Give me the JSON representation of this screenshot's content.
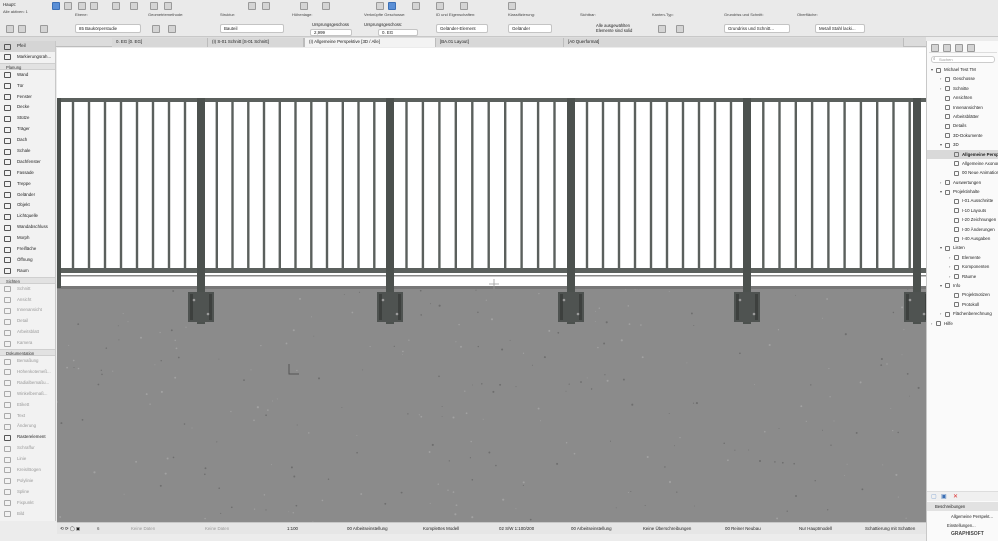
{
  "infobox": {
    "title": "Haupt:",
    "selected": "Alle aktiven: 1",
    "groups": {
      "ebene": {
        "label": "Ebene:",
        "value": "85 Baukörperstudie"
      },
      "geometry": {
        "label": "Geometriemethode:"
      },
      "struktur": {
        "label": "Struktur:",
        "value": "Bauteil"
      },
      "hoehenlage": {
        "label": "Höhenlage:",
        "origin_label": "Ursprungsgeschoss",
        "value": "2,999"
      },
      "geschosse": {
        "label": "Verknüpfte Geschosse:",
        "origin_label": "Ursprungsgeschoss:",
        "value": "0. EG"
      },
      "id": {
        "label": "ID und Eigenschaften:",
        "value": "Geländer-Element"
      },
      "klassifizierung": {
        "label": "Klassifizierung:",
        "value": "Geländer"
      },
      "sichtbar": {
        "label": "Sichtbar:",
        "value": "Alle ausgewählten Elemente sind solid"
      },
      "kanten": {
        "label": "Kanten-Typ:"
      },
      "grundriss": {
        "label": "Grundriss und Schnitt:",
        "value": "Grundriss und Schnitt..."
      },
      "oberflaeche": {
        "label": "Oberfläche:",
        "value": "Metall Stahl lacki..."
      }
    }
  },
  "tabs": [
    {
      "label": "0. EG [0. EG]"
    },
    {
      "label": "(I) S-01 Schnitt [S-01 Schnitt]"
    },
    {
      "label": "(I) Allgemeine Perspektive [3D / Alle]"
    },
    {
      "label": "[BA.01 Layout]"
    },
    {
      "label": "[A0 Querformat]"
    }
  ],
  "toolbox": {
    "sections": [
      {
        "title": "",
        "tools": [
          {
            "label": "Pfeil",
            "dim": false,
            "sel": true
          },
          {
            "label": "Markierungsrah...",
            "dim": false
          }
        ]
      },
      {
        "title": "Planung",
        "tools": [
          {
            "label": "Wand"
          },
          {
            "label": "Tür"
          },
          {
            "label": "Fenster"
          },
          {
            "label": "Decke"
          },
          {
            "label": "Stütze"
          },
          {
            "label": "Träger"
          },
          {
            "label": "Dach"
          },
          {
            "label": "Schale"
          },
          {
            "label": "Dachfenster"
          },
          {
            "label": "Fassade"
          },
          {
            "label": "Treppe"
          },
          {
            "label": "Geländer"
          },
          {
            "label": "Objekt"
          },
          {
            "label": "Lichtquelle"
          },
          {
            "label": "Wandabschluss"
          },
          {
            "label": "Morph"
          },
          {
            "label": "Freifläche"
          },
          {
            "label": "Öffnung"
          },
          {
            "label": "Raum"
          }
        ]
      },
      {
        "title": "Sichten",
        "tools": [
          {
            "label": "Schnitt",
            "dim": true
          },
          {
            "label": "Ansicht",
            "dim": true
          },
          {
            "label": "Innenansicht",
            "dim": true
          },
          {
            "label": "Detail",
            "dim": true
          },
          {
            "label": "Arbeitsblatt",
            "dim": true
          },
          {
            "label": "Kamera",
            "dim": true
          }
        ]
      },
      {
        "title": "Dokumentation",
        "tools": [
          {
            "label": "Bemaßung",
            "dim": true
          },
          {
            "label": "Höhenkotemeß...",
            "dim": true
          },
          {
            "label": "Radialbemaßu...",
            "dim": true
          },
          {
            "label": "Winkelbemaß...",
            "dim": true
          },
          {
            "label": "Etikett",
            "dim": true
          },
          {
            "label": "Text",
            "dim": true
          },
          {
            "label": "Änderung",
            "dim": true
          },
          {
            "label": "Rasterelement"
          },
          {
            "label": "Schraffur",
            "dim": true
          },
          {
            "label": "Linie",
            "dim": true
          },
          {
            "label": "Kreis/Bogen",
            "dim": true
          },
          {
            "label": "Polylinie",
            "dim": true
          },
          {
            "label": "Spline",
            "dim": true
          },
          {
            "label": "Fixpunkt",
            "dim": true
          },
          {
            "label": "Bild",
            "dim": true
          },
          {
            "label": "Zeichnung",
            "dim": true
          }
        ]
      }
    ]
  },
  "navigator": {
    "search_placeholder": "Suchen",
    "items": [
      {
        "label": "Michael Test TM",
        "level": 0,
        "arrow": "▾"
      },
      {
        "label": "Geschosse",
        "level": 1,
        "arrow": "›"
      },
      {
        "label": "Schnitte",
        "level": 1,
        "arrow": "›"
      },
      {
        "label": "Ansichten",
        "level": 1,
        "arrow": ""
      },
      {
        "label": "Innenansichten",
        "level": 1,
        "arrow": ""
      },
      {
        "label": "Arbeitsblätter",
        "level": 1,
        "arrow": ""
      },
      {
        "label": "Details",
        "level": 1,
        "arrow": ""
      },
      {
        "label": "3D-Dokumente",
        "level": 1,
        "arrow": ""
      },
      {
        "label": "3D",
        "level": 1,
        "arrow": "▾"
      },
      {
        "label": "Allgemeine Perspektive",
        "level": 2,
        "arrow": "",
        "sel": true
      },
      {
        "label": "Allgemeine Axonometrie",
        "level": 2,
        "arrow": ""
      },
      {
        "label": "00 Neue Animationen",
        "level": 2,
        "arrow": ""
      },
      {
        "label": "Auswertungen",
        "level": 1,
        "arrow": "›"
      },
      {
        "label": "Projektinhalte",
        "level": 1,
        "arrow": "▾"
      },
      {
        "label": "I-01 Ausschnitte",
        "level": 2,
        "arrow": ""
      },
      {
        "label": "I-10 Layouts",
        "level": 2,
        "arrow": ""
      },
      {
        "label": "I-20 Zeichnungen",
        "level": 2,
        "arrow": ""
      },
      {
        "label": "I-30 Änderungen",
        "level": 2,
        "arrow": ""
      },
      {
        "label": "I-40 Ausgaben",
        "level": 2,
        "arrow": ""
      },
      {
        "label": "Listen",
        "level": 1,
        "arrow": "▾"
      },
      {
        "label": "Elemente",
        "level": 2,
        "arrow": "›"
      },
      {
        "label": "Komponenten",
        "level": 2,
        "arrow": "›"
      },
      {
        "label": "Räume",
        "level": 2,
        "arrow": "›"
      },
      {
        "label": "Info",
        "level": 1,
        "arrow": "▾"
      },
      {
        "label": "Projektnotizen",
        "level": 2,
        "arrow": ""
      },
      {
        "label": "Protokoll",
        "level": 2,
        "arrow": ""
      },
      {
        "label": "Flächenberechnung",
        "level": 1,
        "arrow": "›"
      },
      {
        "label": "Hilfe",
        "level": 0,
        "arrow": "›"
      }
    ],
    "descriptions_title": "Beschreibungen",
    "current_view": "Allgemeine Perspekt...",
    "settings_button": "Einstellungen...",
    "brand": "GRAPHISOFT"
  },
  "statusbar": {
    "undo_a": "Keine Daten",
    "undo_b": "Keine Daten",
    "scale": "1:100",
    "layer_combo": "00 Arbeitseinstellung",
    "model_view": "Komplettes Modell",
    "pen_set": "02 S/W 1:100/200",
    "layer_combo2": "00 Arbeitseinstellung",
    "overrides": "Keine Überschreibungen",
    "renovation": "00 Reiner Neubau",
    "model_filter": "Nur Hauptmodell",
    "shading": "Schattierung mit Schatten"
  },
  "colors": {
    "railing": "#5b605d",
    "ground": "#8b8b8b",
    "sky": "#ffffff",
    "accent": "#3b6fb5"
  }
}
